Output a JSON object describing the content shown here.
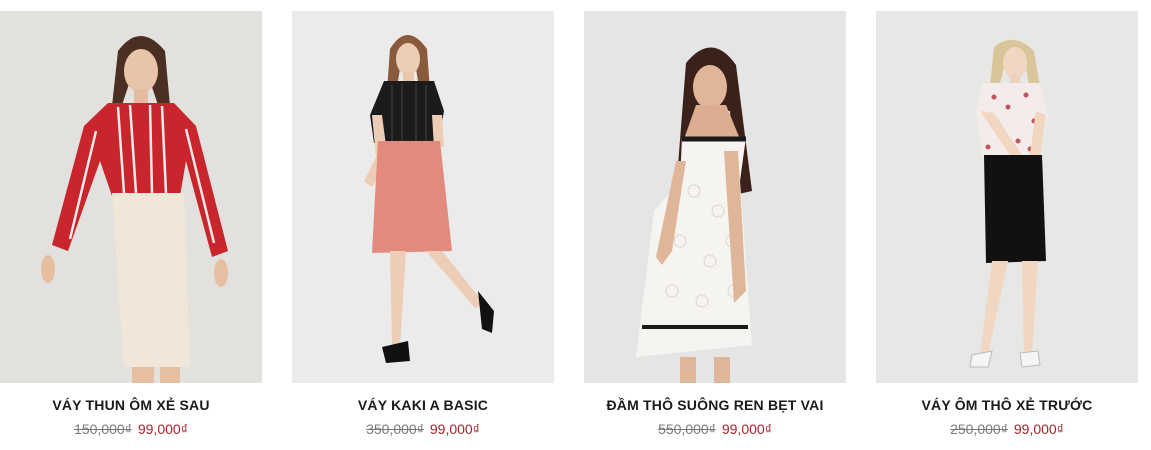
{
  "products": [
    {
      "name": "VÁY THUN ÔM XẺ SAU",
      "old_price": "150,000₫",
      "price": "99,000₫",
      "image": "model-red-striped-shirt-cream-skirt"
    },
    {
      "name": "VÁY KAKI A BASIC",
      "old_price": "350,000₫",
      "price": "99,000₫",
      "image": "model-black-shirt-pink-skirt"
    },
    {
      "name": "ĐẦM THÔ SUÔNG REN BẸT VAI",
      "old_price": "550,000₫",
      "price": "99,000₫",
      "image": "model-white-lace-off-shoulder-dress"
    },
    {
      "name": "VÁY ÔM THÔ XẺ TRƯỚC",
      "old_price": "250,000₫",
      "price": "99,000₫",
      "image": "model-floral-blouse-black-skirt"
    }
  ],
  "colors": {
    "sale_price": "#a8232a",
    "old_price": "#7a7a7a",
    "product_name": "#1a1a1a",
    "photo_background": "#e9e9e9"
  }
}
